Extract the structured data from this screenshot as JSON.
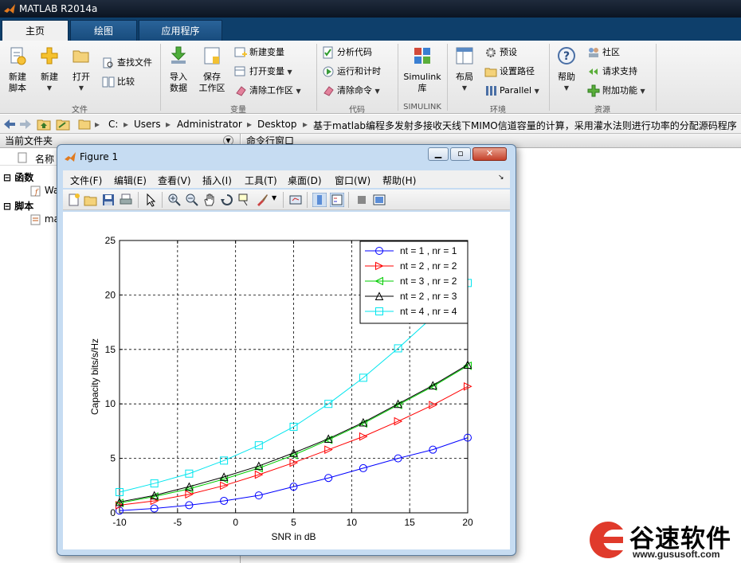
{
  "app": {
    "title": "MATLAB R2014a"
  },
  "ribbon_tabs": [
    "主页",
    "绘图",
    "应用程序"
  ],
  "ribbon": {
    "file": {
      "label": "文件",
      "new_script": [
        "新建",
        "脚本"
      ],
      "new": "新建",
      "open": "打开",
      "find_files": "查找文件",
      "compare": "比较"
    },
    "variable": {
      "label": "变量",
      "import": [
        "导入",
        "数据"
      ],
      "save_workspace": [
        "保存",
        "工作区"
      ],
      "new_variable": "新建变量",
      "open_variable": "打开变量",
      "clear_workspace": "清除工作区"
    },
    "code": {
      "label": "代码",
      "analyze": "分析代码",
      "run_time": "运行和计时",
      "clear_commands": "清除命令"
    },
    "simulink": {
      "label": "SIMULINK",
      "lib": [
        "Simulink",
        "库"
      ]
    },
    "environment": {
      "label": "环境",
      "layout": "布局",
      "preferences": "预设",
      "set_path": "设置路径",
      "parallel": "Parallel"
    },
    "resources": {
      "label": "资源",
      "help": "帮助",
      "community": "社区",
      "support": "请求支持",
      "addons": "附加功能"
    }
  },
  "address": {
    "crumbs": [
      "C:",
      "Users",
      "Administrator",
      "Desktop",
      "基于matlab编程多发射多接收天线下MIMO信道容量的计算，采用灌水法则进行功率的分配源码程序"
    ]
  },
  "current_folder": {
    "title": "当前文件夹",
    "col_name": "名称",
    "groups": [
      {
        "label": "函数",
        "item": "Wa"
      },
      {
        "label": "脚本",
        "item": "ma"
      }
    ]
  },
  "command_window": {
    "title": "命令行窗口"
  },
  "figure": {
    "title": "Figure 1",
    "menu": [
      "文件(F)",
      "编辑(E)",
      "查看(V)",
      "插入(I)",
      "工具(T)",
      "桌面(D)",
      "窗口(W)",
      "帮助(H)"
    ]
  },
  "chart_data": {
    "type": "line",
    "title": "",
    "xlabel": "SNR in dB",
    "ylabel": "Capacity bits/s/Hz",
    "xlim": [
      -10,
      20
    ],
    "ylim": [
      0,
      25
    ],
    "xticks": [
      -10,
      -5,
      0,
      5,
      10,
      15,
      20
    ],
    "yticks": [
      0,
      5,
      10,
      15,
      20,
      25
    ],
    "grid": true,
    "legend_position": "top-right",
    "x": [
      -10,
      -7,
      -4,
      -1,
      2,
      5,
      8,
      11,
      14,
      17,
      20
    ],
    "series": [
      {
        "name": "nt = 1 , nr = 1",
        "color": "#0000ff",
        "marker": "circle",
        "values": [
          0.2,
          0.4,
          0.7,
          1.1,
          1.6,
          2.4,
          3.2,
          4.1,
          5.0,
          5.8,
          6.9
        ]
      },
      {
        "name": "nt = 2 , nr = 2",
        "color": "#ff0000",
        "marker": "triangle-right",
        "values": [
          0.7,
          1.1,
          1.7,
          2.5,
          3.5,
          4.6,
          5.8,
          7.0,
          8.4,
          9.9,
          11.6
        ]
      },
      {
        "name": "nt = 3 , nr = 2",
        "color": "#00cc00",
        "marker": "triangle-left",
        "values": [
          0.9,
          1.5,
          2.2,
          3.1,
          4.1,
          5.3,
          6.7,
          8.2,
          9.9,
          11.6,
          13.5
        ]
      },
      {
        "name": "nt = 2 , nr = 3",
        "color": "#000000",
        "marker": "triangle-up",
        "values": [
          1.0,
          1.6,
          2.4,
          3.3,
          4.3,
          5.5,
          6.8,
          8.3,
          10.0,
          11.7,
          13.6
        ]
      },
      {
        "name": "nt = 4 , nr = 4",
        "color": "#00e5ee",
        "marker": "square",
        "values": [
          1.9,
          2.7,
          3.6,
          4.8,
          6.2,
          7.9,
          10.0,
          12.4,
          15.1,
          18.0,
          21.1
        ]
      }
    ]
  },
  "watermark": {
    "name": "谷速软件",
    "url": "www.gususoft.com"
  }
}
